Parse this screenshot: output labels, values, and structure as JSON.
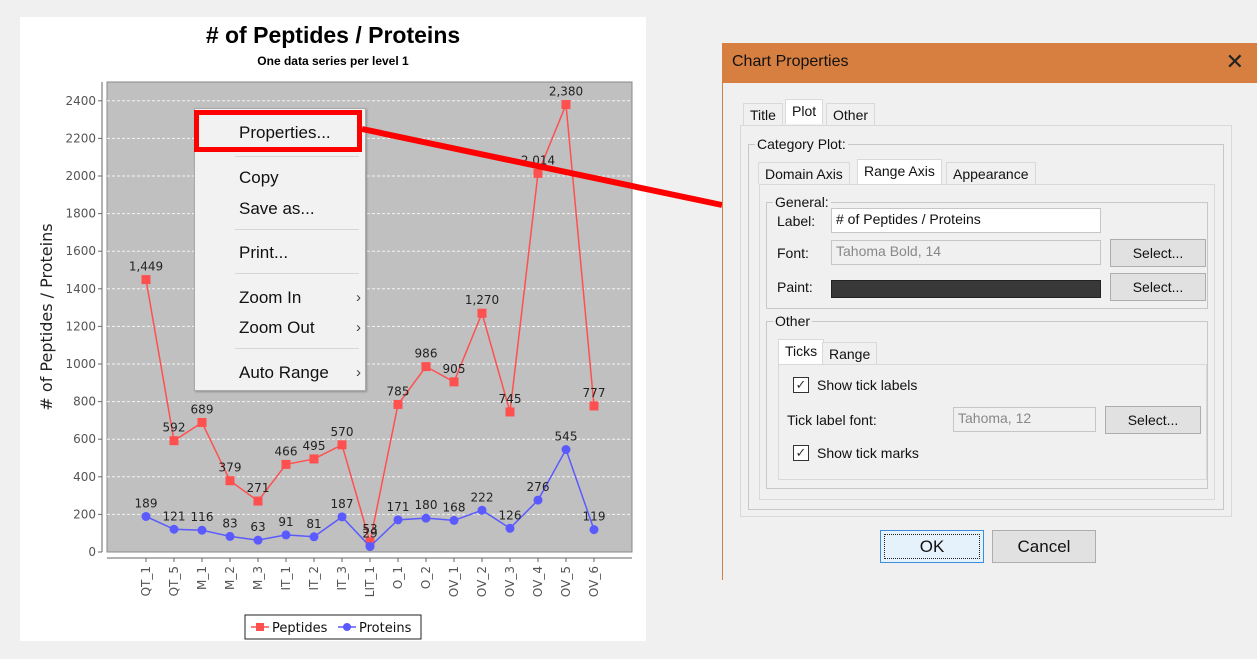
{
  "chart_data": {
    "type": "line",
    "title": "# of Peptides / Proteins",
    "subtitle": "One data series per level 1",
    "xlabel": "",
    "ylabel": "# of Peptides / Proteins",
    "ylim": [
      0,
      2500
    ],
    "yticks": [
      0,
      200,
      400,
      600,
      800,
      1000,
      1200,
      1400,
      1600,
      1800,
      2000,
      2200,
      2400
    ],
    "grid": true,
    "legend_position": "bottom",
    "categories": [
      "QT_1",
      "QT_5",
      "M_1",
      "M_2",
      "M_3",
      "IT_1",
      "IT_2",
      "IT_3",
      "LIT_1",
      "O_1",
      "O_2",
      "OV_1",
      "OV_2",
      "OV_3",
      "OV_4",
      "OV_5",
      "OV_6"
    ],
    "series": [
      {
        "name": "Peptides",
        "color": "#ff5050",
        "marker": "square",
        "values": [
          1449,
          592,
          689,
          379,
          271,
          466,
          495,
          570,
          53,
          785,
          986,
          905,
          1270,
          745,
          2014,
          2380,
          777
        ],
        "labels": [
          "1,449",
          "592",
          "689",
          "379",
          "271",
          "466",
          "495",
          "570",
          "53",
          "785",
          "986",
          "905",
          "1,270",
          "745",
          "2,014",
          "2,380",
          "777"
        ]
      },
      {
        "name": "Proteins",
        "color": "#5a5aff",
        "marker": "circle",
        "values": [
          189,
          121,
          116,
          83,
          63,
          91,
          81,
          187,
          29,
          171,
          180,
          168,
          222,
          126,
          276,
          545,
          119
        ],
        "labels": [
          "189",
          "121",
          "116",
          "83",
          "63",
          "91",
          "81",
          "187",
          "29",
          "171",
          "180",
          "168",
          "222",
          "126",
          "276",
          "545",
          "119"
        ]
      }
    ]
  },
  "context_menu": {
    "items": [
      {
        "label": "Properties...",
        "submenu": false
      },
      {
        "label": "Copy",
        "submenu": false
      },
      {
        "label": "Save as...",
        "submenu": false
      },
      {
        "label": "Print...",
        "submenu": false
      },
      {
        "label": "Zoom In",
        "submenu": true
      },
      {
        "label": "Zoom Out",
        "submenu": true
      },
      {
        "label": "Auto Range",
        "submenu": true
      }
    ],
    "arrow": "›",
    "highlight_color": "#ff0000"
  },
  "dialog": {
    "title": "Chart Properties",
    "close_icon": "✕",
    "titlebar_color": "#d77f40",
    "tabs": [
      "Title",
      "Plot",
      "Other"
    ],
    "active_tab": "Plot",
    "group_category_plot": "Category Plot:",
    "subtabs": [
      "Domain Axis",
      "Range Axis",
      "Appearance"
    ],
    "active_subtab": "Range Axis",
    "general": {
      "title": "General:",
      "label_label": "Label:",
      "label_value": "# of Peptides / Proteins",
      "font_label": "Font:",
      "font_value": "Tahoma Bold, 14",
      "paint_label": "Paint:",
      "paint_color": "#383838",
      "select_label": "Select..."
    },
    "other": {
      "title": "Other",
      "tabs": [
        "Ticks",
        "Range"
      ],
      "active_tab": "Ticks",
      "show_tick_labels": {
        "label": "Show tick labels",
        "checked": true
      },
      "tick_label_font_label": "Tick label font:",
      "tick_label_font_value": "Tahoma, 12",
      "select_label": "Select...",
      "show_tick_marks": {
        "label": "Show tick marks",
        "checked": true
      },
      "check_glyph": "✓"
    },
    "ok_label": "OK",
    "cancel_label": "Cancel"
  }
}
